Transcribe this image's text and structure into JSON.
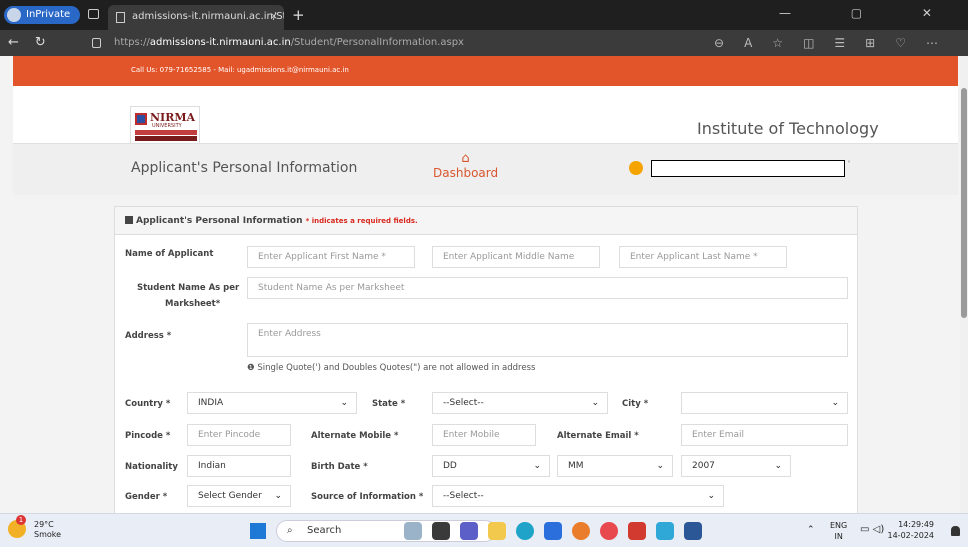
{
  "browser": {
    "inprivate_label": "InPrivate",
    "tab_title": "admissions-it.nirmauni.ac.in/Stuc",
    "tab_close": "×",
    "new_tab": "+",
    "url_prefix": "https://",
    "url_host": "admissions-it.nirmauni.ac.in",
    "url_path": "/Student/PersonalInformation.aspx",
    "window_buttons": "— ▢ ✕"
  },
  "site": {
    "contact_strip": "Call Us: 079-71652585 - Mail: ugadmissions.it@nirmauni.ac.in",
    "logo_text": "NIRMA",
    "logo_sub": "UNIVERSITY",
    "institute_title": "Institute of Technology",
    "page_title": "Applicant's Personal Information",
    "dashboard_label": "Dashboard",
    "dashboard_icon": "home-icon"
  },
  "form": {
    "panel_title": "Applicant's Personal Information",
    "required_note": "* indicates a required fields.",
    "name_label": "Name of Applicant",
    "first_name_ph": "Enter Applicant First Name *",
    "middle_name_ph": "Enter Applicant Middle Name",
    "last_name_ph": "Enter Applicant Last Name *",
    "marksheet_label_1": "Student Name As per",
    "marksheet_label_2": "Marksheet*",
    "marksheet_ph": "Student Name As per Marksheet",
    "address_label": "Address *",
    "address_ph": "Enter Address",
    "address_note": "Single Quote(') and Doubles Quotes(\") are not allowed in address",
    "country_label": "Country *",
    "country_value": "INDIA",
    "state_label": "State *",
    "state_value": "--Select--",
    "city_label": "City *",
    "city_value": "",
    "pincode_label": "Pincode *",
    "pincode_ph": "Enter Pincode",
    "alt_mobile_label": "Alternate Mobile *",
    "alt_mobile_ph": "Enter Mobile",
    "alt_email_label": "Alternate Email *",
    "alt_email_ph": "Enter Email",
    "nationality_label": "Nationality",
    "nationality_value": "Indian",
    "birth_label": "Birth Date *",
    "birth_dd": "DD",
    "birth_mm": "MM",
    "birth_yyyy": "2007",
    "gender_label": "Gender *",
    "gender_value": "Select Gender",
    "source_label": "Source of Information *",
    "source_value": "--Select--"
  },
  "taskbar": {
    "temperature": "29°C",
    "weather_desc": "Smoke",
    "weather_badge": "1",
    "search_label": "Search",
    "lang_1": "ENG",
    "lang_2": "IN",
    "time": "14:29:49",
    "date": "14-02-2024"
  }
}
